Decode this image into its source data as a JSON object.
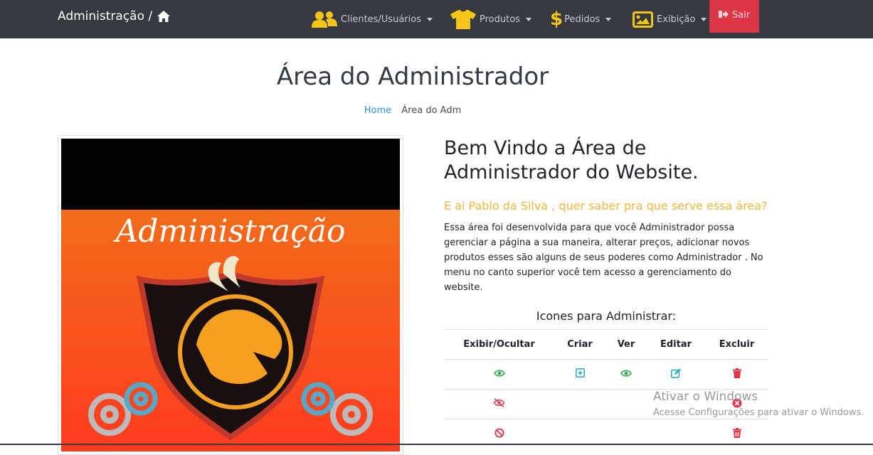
{
  "nav": {
    "brand": "Administração /",
    "items": [
      {
        "label": "Clientes/Usuários",
        "icon": "users-icon"
      },
      {
        "label": "Produtos",
        "icon": "tshirt-icon"
      },
      {
        "label": "Pedidos",
        "icon": "dollar-icon"
      },
      {
        "label": "Exibição",
        "icon": "image-icon"
      }
    ],
    "logout": "Sair"
  },
  "page": {
    "title": "Área do Administrador",
    "breadcrumb": {
      "home": "Home",
      "current": "Área do Adm"
    }
  },
  "banner": {
    "text": "Administração"
  },
  "main": {
    "welcome": "Bem Vindo a Área de Administrador do Website.",
    "lead": "E ai Pablo da Silva , quer saber pra que serve essa área?",
    "paragraph": "Essa área foi desenvolvida para que você Administrador possa gerenciar a página a sua maneira, alterar preços, adicionar novos produtos esses são alguns de seus poderes como Administrador . No menu no canto superior você tem acesso a gerenciamento do website."
  },
  "icons_table": {
    "title": "Icones para Administrar:",
    "headers": [
      "Exibir/Ocultar",
      "Criar",
      "Ver",
      "Editar",
      "Excluir"
    ]
  },
  "watermark": {
    "line1": "Ativar o Windows",
    "line2": "Acesse Configurações para ativar o Windows."
  },
  "colors": {
    "navbar": "#343a40",
    "accent": "#f5c518",
    "danger": "#dc3545",
    "success": "#28a745",
    "info": "#17a2b8"
  }
}
